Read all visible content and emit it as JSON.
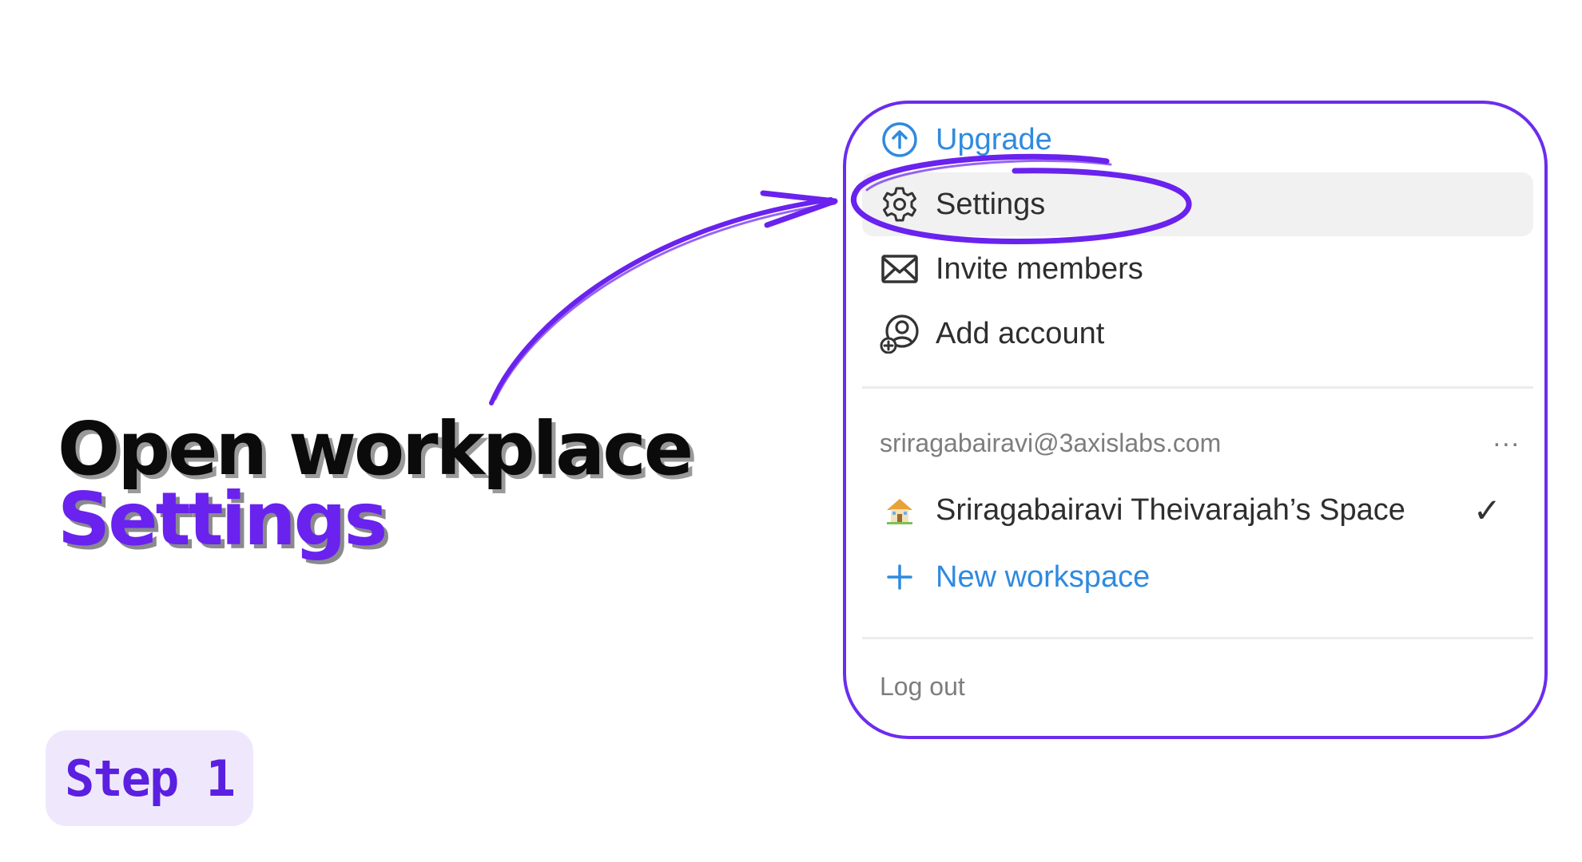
{
  "headline": {
    "line1": "Open workplace",
    "line2": "Settings"
  },
  "step_badge": {
    "label": "Step 1"
  },
  "menu": {
    "upgrade": {
      "label": "Upgrade",
      "icon": "arrow-up-circle-icon"
    },
    "settings": {
      "label": "Settings",
      "icon": "gear-icon"
    },
    "invite": {
      "label": "Invite members",
      "icon": "envelope-icon"
    },
    "add_account": {
      "label": "Add account",
      "icon": "add-user-icon"
    },
    "account_email": "sriragabairavi@3axislabs.com",
    "more_label": "...",
    "workspace": {
      "label": "Sriragabairavi Theivarajah’s Space",
      "icon": "house-icon",
      "checkmark": "✓"
    },
    "new_workspace": {
      "label": "New workspace",
      "icon": "plus-icon"
    },
    "logout_label": "Log out"
  },
  "colors": {
    "accent_purple": "#6a22ee",
    "link_blue": "#2f8ae0",
    "badge_bg": "#efe8fd",
    "highlight_bg": "#f1f1f1"
  }
}
